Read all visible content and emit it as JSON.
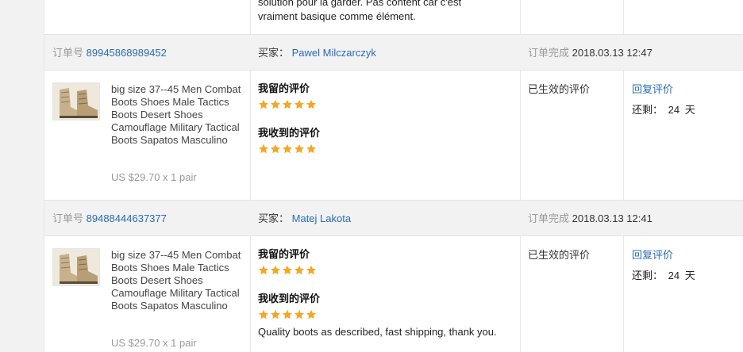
{
  "top_review": {
    "text_line1": "solution pour la garder. Pas content car c'est",
    "text_line2": "vraiment basique comme élément."
  },
  "labels": {
    "order_no": "订单号",
    "buyer": "买家：",
    "completed": "订单完成",
    "my_review": "我留的评价",
    "received_review": "我收到的评价",
    "status": "已生效的评价",
    "reply": "回复评价",
    "remaining_prefix": "还剩：",
    "remaining_suffix": "天"
  },
  "colors": {
    "link": "#2a6db5",
    "star": "#f5a623",
    "header_bg": "#f2f2f2"
  },
  "orders": [
    {
      "order_id": "89945868989452",
      "buyer": "Pawel Milczarczyk",
      "completed_at": "2018.03.13 12:47",
      "product": {
        "image_icon": "tactical-boots-thumbnail",
        "title": "big size 37--45 Men Combat Boots Shoes Male Tactics Boots Desert Shoes Camouflage Military Tactical Boots Sapatos Masculino",
        "price": "US $29.70 x 1 pair"
      },
      "my_review_stars": 5,
      "received_review_stars": 5,
      "received_comment": "",
      "status": "已生效的评价",
      "days_left": "24"
    },
    {
      "order_id": "89488444637377",
      "buyer": "Matej Lakota",
      "completed_at": "2018.03.13 12:41",
      "product": {
        "image_icon": "tactical-boots-thumbnail",
        "title": "big size 37--45 Men Combat Boots Shoes Male Tactics Boots Desert Shoes Camouflage Military Tactical Boots Sapatos Masculino",
        "price": "US $29.70 x 1 pair"
      },
      "my_review_stars": 5,
      "received_review_stars": 5,
      "received_comment": "Quality boots as described, fast shipping, thank you.",
      "status": "已生效的评价",
      "days_left": "24"
    }
  ]
}
